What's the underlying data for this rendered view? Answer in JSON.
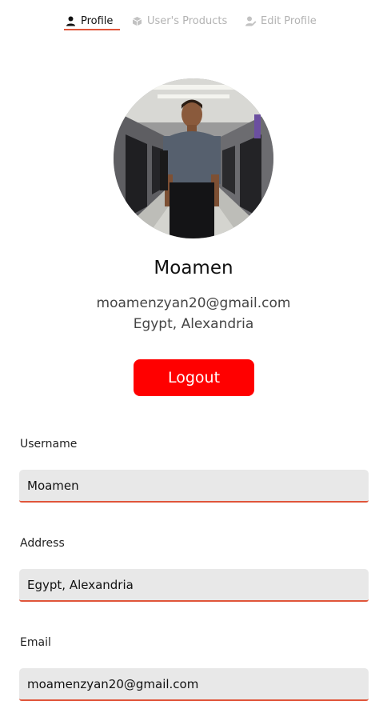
{
  "tabs": [
    {
      "label": "Profile",
      "icon": "user-icon",
      "active": true
    },
    {
      "label": "User's Products",
      "icon": "box-icon",
      "active": false
    },
    {
      "label": "Edit Profile",
      "icon": "user-edit-icon",
      "active": false
    }
  ],
  "profile": {
    "name": "Moamen",
    "email": "moamenzyan20@gmail.com",
    "location": "Egypt, Alexandria",
    "logout_label": "Logout"
  },
  "form": {
    "username": {
      "label": "Username",
      "value": "Moamen"
    },
    "address": {
      "label": "Address",
      "value": "Egypt, Alexandria"
    },
    "email": {
      "label": "Email",
      "value": "moamenzyan20@gmail.com"
    }
  },
  "colors": {
    "accent": "#e0553a",
    "logout": "#ff0000",
    "field_bg": "#e8e8e8",
    "inactive_tab": "#b3b3b3"
  }
}
